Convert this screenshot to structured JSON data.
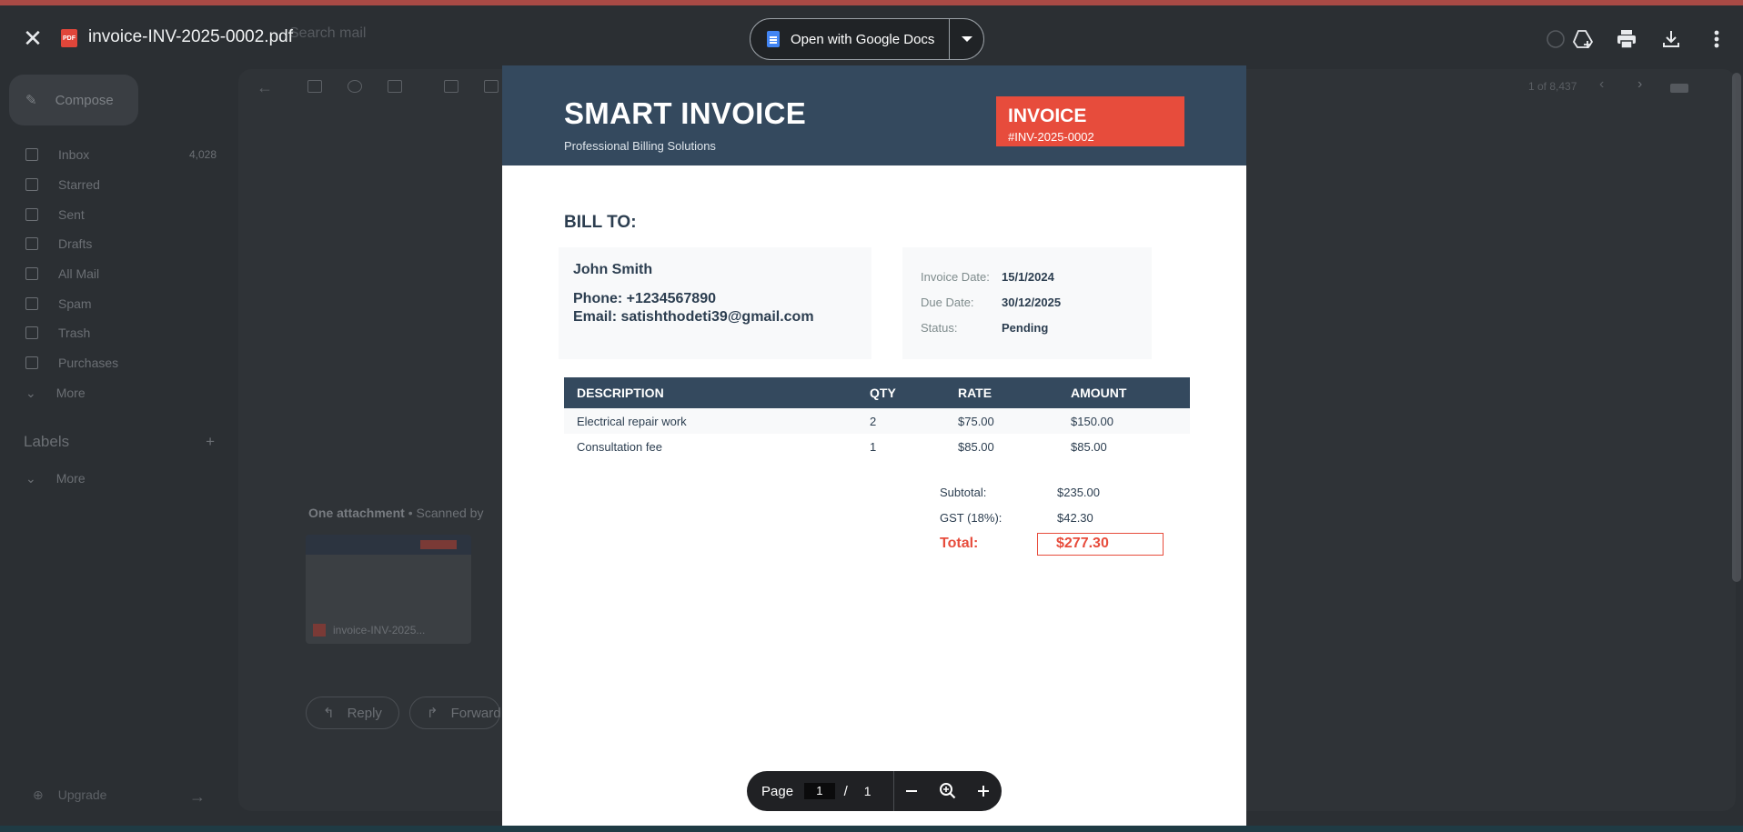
{
  "viewer": {
    "filename": "invoice-INV-2025-0002.pdf",
    "pdf_badge": "PDF",
    "open_with_label": "Open with Google Docs"
  },
  "background": {
    "search_placeholder": "Search mail",
    "compose": "Compose",
    "nav": [
      {
        "label": "Inbox",
        "count": "4,028"
      },
      {
        "label": "Starred",
        "count": ""
      },
      {
        "label": "Sent",
        "count": ""
      },
      {
        "label": "Drafts",
        "count": ""
      },
      {
        "label": "All Mail",
        "count": ""
      },
      {
        "label": "Spam",
        "count": ""
      },
      {
        "label": "Trash",
        "count": ""
      },
      {
        "label": "Purchases",
        "count": ""
      },
      {
        "label": "More",
        "count": ""
      }
    ],
    "labels_heading": "Labels",
    "labels_more": "More",
    "upgrade": "Upgrade",
    "pagination": "1 of 8,437",
    "attachment_heading": "One attachment",
    "attachment_scanned": "• Scanned by",
    "attachment_file": "invoice-INV-2025...",
    "reply": "Reply",
    "forward": "Forward"
  },
  "invoice": {
    "brand": "SMART INVOICE",
    "tagline": "Professional Billing Solutions",
    "tag_title": "INVOICE",
    "tag_number": "#INV-2025-0002",
    "bill_to_heading": "BILL TO:",
    "customer": {
      "name": "John Smith",
      "phone": "Phone: +1234567890",
      "email": "Email: satishthodeti39@gmail.com"
    },
    "meta": [
      {
        "label": "Invoice Date:",
        "value": "15/1/2024"
      },
      {
        "label": "Due Date:",
        "value": "30/12/2025"
      },
      {
        "label": "Status:",
        "value": "Pending"
      }
    ],
    "columns": [
      "DESCRIPTION",
      "QTY",
      "RATE",
      "AMOUNT"
    ],
    "items": [
      {
        "description": "Electrical repair work",
        "qty": "2",
        "rate": "$75.00",
        "amount": "$150.00"
      },
      {
        "description": "Consultation fee",
        "qty": "1",
        "rate": "$85.00",
        "amount": "$85.00"
      }
    ],
    "subtotal_label": "Subtotal:",
    "subtotal_value": "$235.00",
    "gst_label": "GST (18%):",
    "gst_value": "$42.30",
    "total_label": "Total:",
    "total_value": "$277.30"
  },
  "pager": {
    "label": "Page",
    "current": "1",
    "separator": "/",
    "total": "1"
  },
  "colors": {
    "header": "#34495e",
    "accent": "#e74c3c",
    "overlay": "#2b2f33"
  }
}
